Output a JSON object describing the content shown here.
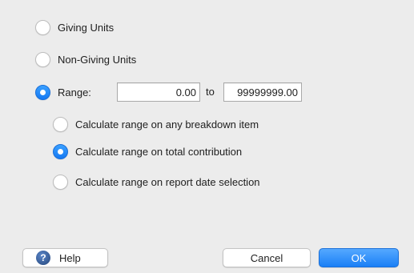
{
  "options": {
    "giving_units": "Giving Units",
    "non_giving_units": "Non-Giving Units",
    "range": "Range:"
  },
  "range": {
    "from_value": "0.00",
    "to_label": "to",
    "to_value": "99999999.00"
  },
  "sub_options": {
    "any_breakdown": "Calculate range on any breakdown item",
    "total_contribution": "Calculate range on total contribution",
    "report_date": "Calculate range on report date selection"
  },
  "buttons": {
    "help": "Help",
    "help_icon": "?",
    "cancel": "Cancel",
    "ok": "OK"
  },
  "selected": {
    "main": "range",
    "sub": "total_contribution"
  },
  "colors": {
    "accent": "#1a7ff6",
    "background": "#ececec"
  }
}
